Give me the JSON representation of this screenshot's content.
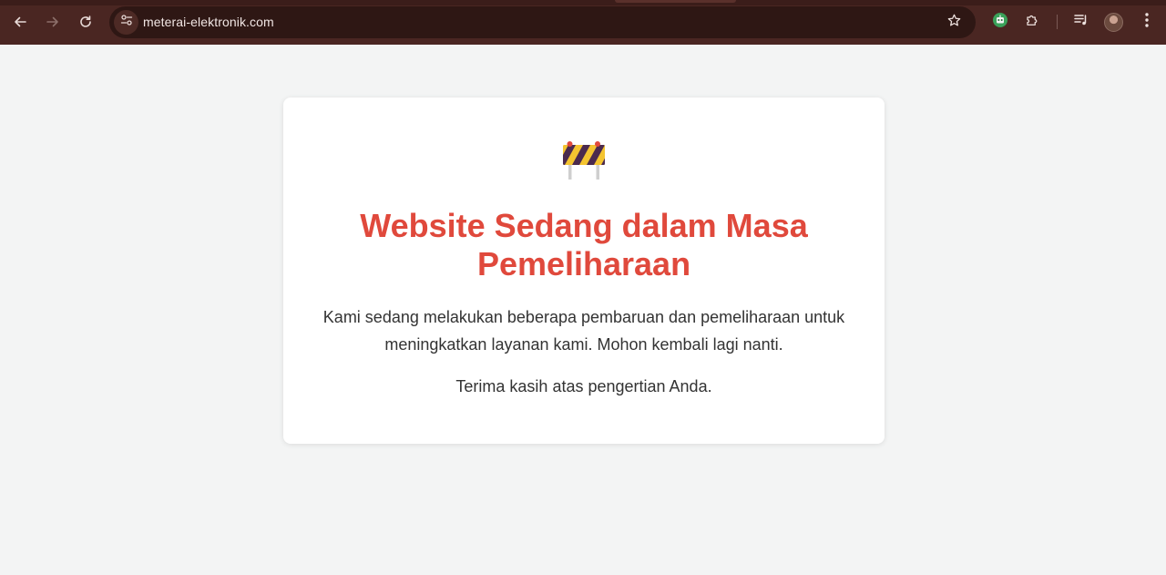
{
  "browser": {
    "url": "meterai-elektronik.com",
    "icons": {
      "back": "arrow-left-icon",
      "forward": "arrow-right-icon",
      "reload": "reload-icon",
      "site_info": "tune-icon",
      "bookmark": "star-icon",
      "extension_robot": "robot-extension-icon",
      "extensions": "puzzle-icon",
      "media": "playlist-icon",
      "profile": "avatar",
      "menu": "kebab-menu-icon"
    },
    "colors": {
      "chrome_background": "#4a2622",
      "omnibox_background": "#2e1714"
    }
  },
  "page": {
    "title": "Website Sedang dalam Masa Pemeliharaan",
    "message": "Kami sedang melakukan beberapa pembaruan dan pemeliharaan untuk meningkatkan layanan kami. Mohon kembali lagi nanti.",
    "thanks": "Terima kasih atas pengertian Anda.",
    "icon": "construction-barrier-icon",
    "colors": {
      "title": "#e0493c",
      "background": "#f3f4f4",
      "card": "#ffffff"
    }
  }
}
